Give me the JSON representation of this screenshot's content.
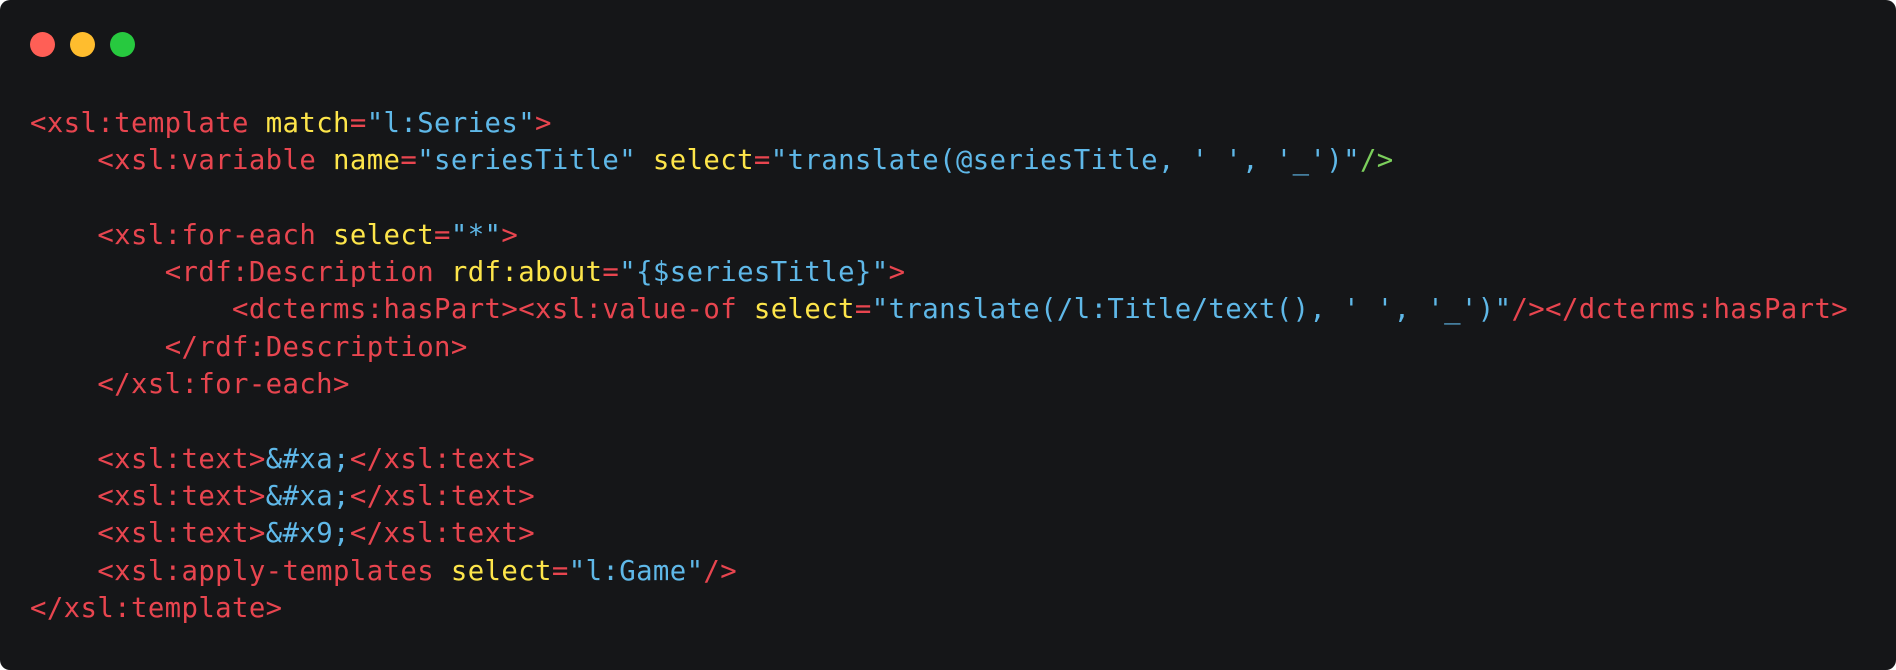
{
  "window": {
    "background": "#151618",
    "buttons": [
      {
        "name": "close-button",
        "color": "#ff5f56"
      },
      {
        "name": "minimize-button",
        "color": "#ffbd2e"
      },
      {
        "name": "maximize-button",
        "color": "#27c93f"
      }
    ]
  },
  "theme": {
    "tag": "#e8454f",
    "attr": "#fde54a",
    "value": "#5fb8e8",
    "punct": "#7ccf5c",
    "plain": "#d3d3d3"
  },
  "code_lines": [
    [
      [
        "tag",
        "<xsl:template "
      ],
      [
        "attr",
        "match"
      ],
      [
        "tag",
        "="
      ],
      [
        "value",
        "\"l:Series\""
      ],
      [
        "tag",
        ">"
      ]
    ],
    [
      [
        "plain",
        "    "
      ],
      [
        "tag",
        "<xsl:variable "
      ],
      [
        "attr",
        "name"
      ],
      [
        "tag",
        "="
      ],
      [
        "value",
        "\"seriesTitle\" "
      ],
      [
        "attr",
        "select"
      ],
      [
        "tag",
        "="
      ],
      [
        "value",
        "\"translate(@seriesTitle, ' ', '_')\""
      ],
      [
        "punct",
        "/>"
      ]
    ],
    [],
    [
      [
        "plain",
        "    "
      ],
      [
        "tag",
        "<xsl:for-each "
      ],
      [
        "attr",
        "select"
      ],
      [
        "tag",
        "="
      ],
      [
        "value",
        "\"*\""
      ],
      [
        "tag",
        ">"
      ]
    ],
    [
      [
        "plain",
        "        "
      ],
      [
        "tag",
        "<rdf:Description "
      ],
      [
        "attr",
        "rdf:about"
      ],
      [
        "tag",
        "="
      ],
      [
        "value",
        "\"{$seriesTitle}\""
      ],
      [
        "tag",
        ">"
      ]
    ],
    [
      [
        "plain",
        "            "
      ],
      [
        "tag",
        "<dcterms:hasPart><xsl:value-of "
      ],
      [
        "attr",
        "select"
      ],
      [
        "tag",
        "="
      ],
      [
        "value",
        "\"translate(/l:Title/text(), ' ', '_')\""
      ],
      [
        "tag",
        "/></dcterms:hasPart>"
      ]
    ],
    [
      [
        "plain",
        "        "
      ],
      [
        "tag",
        "</rdf:Description>"
      ]
    ],
    [
      [
        "plain",
        "    "
      ],
      [
        "tag",
        "</xsl:for-each>"
      ]
    ],
    [],
    [
      [
        "plain",
        "    "
      ],
      [
        "tag",
        "<xsl:text>"
      ],
      [
        "value",
        "&#xa;"
      ],
      [
        "tag",
        "</xsl:text>"
      ]
    ],
    [
      [
        "plain",
        "    "
      ],
      [
        "tag",
        "<xsl:text>"
      ],
      [
        "value",
        "&#xa;"
      ],
      [
        "tag",
        "</xsl:text>"
      ]
    ],
    [
      [
        "plain",
        "    "
      ],
      [
        "tag",
        "<xsl:text>"
      ],
      [
        "value",
        "&#x9;"
      ],
      [
        "tag",
        "</xsl:text>"
      ]
    ],
    [
      [
        "plain",
        "    "
      ],
      [
        "tag",
        "<xsl:apply-templates "
      ],
      [
        "attr",
        "select"
      ],
      [
        "tag",
        "="
      ],
      [
        "value",
        "\"l:Game\""
      ],
      [
        "tag",
        "/>"
      ]
    ],
    [
      [
        "tag",
        "</xsl:template>"
      ]
    ]
  ]
}
